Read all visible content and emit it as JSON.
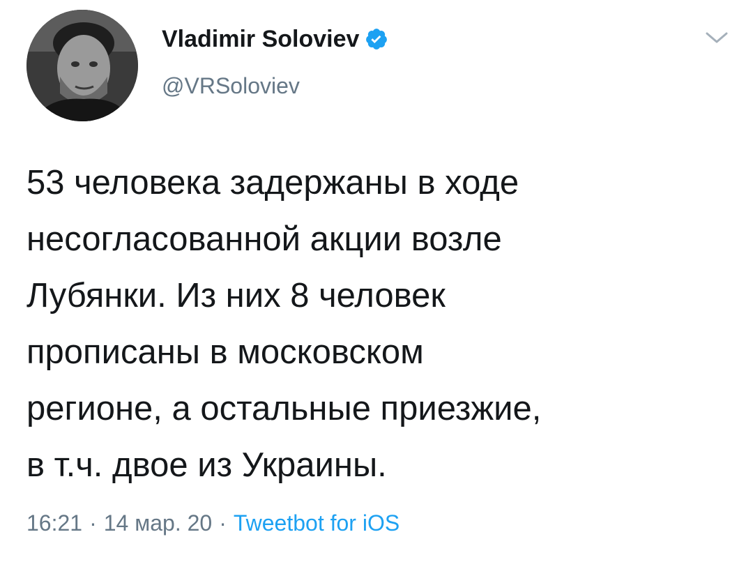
{
  "author": {
    "display_name": "Vladimir Soloviev",
    "handle": "@VRSoloviev",
    "verified": true,
    "avatar_icon": "profile-photo"
  },
  "tweet": {
    "text": "53 человека задержаны в ходе\nнесогласованной акции возле\nЛубянки. Из них 8 человек\nпрописаны в московском\nрегионе, а остальные приезжие,\nв т.ч. двое из Украины."
  },
  "meta": {
    "time": "16:21",
    "date": "14 мар. 20",
    "separator": "·",
    "source": "Tweetbot for iOS"
  },
  "colors": {
    "text": "#14171a",
    "secondary": "#657786",
    "link": "#1da1f2",
    "verified_badge": "#1da1f2"
  },
  "icons": {
    "verified": "verified-badge-icon",
    "menu": "chevron-down-icon"
  }
}
